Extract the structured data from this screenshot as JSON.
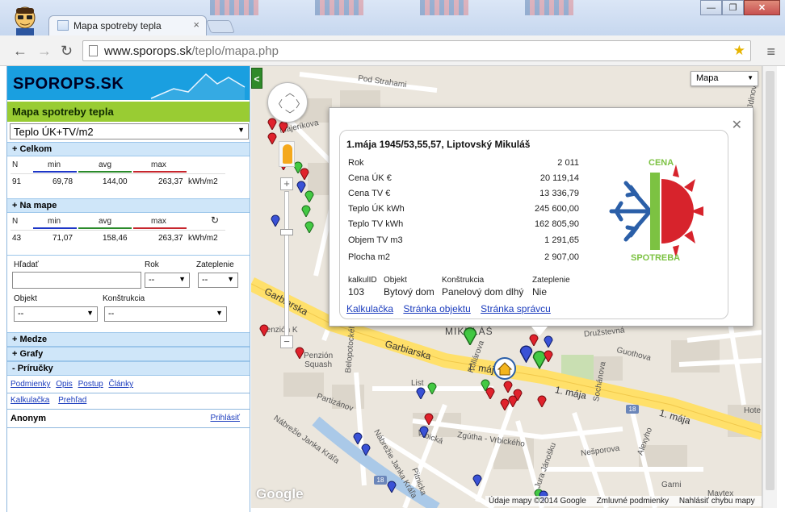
{
  "browser": {
    "tab_title": "Mapa spotreby tepla",
    "url_host": "www.sporops.sk",
    "url_path": "/teplo/mapa.php"
  },
  "sidebar": {
    "logo": "SPOROPS.SK",
    "map_title": "Mapa spotreby tepla",
    "metric_select": "Teplo ÚK+TV/m2",
    "celkom": {
      "header": "+ Celkom",
      "labels": {
        "n": "N",
        "min": "min",
        "avg": "avg",
        "max": "max"
      },
      "values": {
        "n": "91",
        "min": "69,78",
        "avg": "144,00",
        "max": "263,37",
        "unit": "kWh/m2"
      }
    },
    "na_mape": {
      "header": "+ Na mape",
      "labels": {
        "n": "N",
        "min": "min",
        "avg": "avg",
        "max": "max"
      },
      "values": {
        "n": "43",
        "min": "71,07",
        "avg": "158,46",
        "max": "263,37",
        "unit": "kWh/m2"
      }
    },
    "filters": {
      "search_label": "Hľadať",
      "search_value": "",
      "rok_label": "Rok",
      "rok_value": "--",
      "zateplenie_label": "Zateplenie",
      "zateplenie_value": "--",
      "objekt_label": "Objekt",
      "objekt_value": "--",
      "konstrukcia_label": "Konštrukcia",
      "konstrukcia_value": "--"
    },
    "sections": {
      "medze": "+ Medze",
      "grafy": "+ Grafy",
      "prirucky": "- Príručky"
    },
    "links_row1": [
      "Podmienky",
      "Opis",
      "Postup",
      "Články"
    ],
    "links_row2": [
      "Kalkulačka",
      "Prehľad"
    ],
    "user": "Anonym",
    "login": "Prihlásiť"
  },
  "map": {
    "type_select": "Mapa",
    "collapse": "<",
    "streets": {
      "pod_strahami": "Pod Strahami",
      "majerikova": "Majeríkova",
      "garbiarska1": "Garbiarska",
      "garbiarska2": "Garbiarska",
      "maja1": "1. mája",
      "maja2": "1. mája",
      "maja3": "1. mája",
      "penzion_k": "Penzión K",
      "pension_squash": "Penzión\nSquash",
      "partizanov": "Partizánov",
      "belopotockeho": "Belopotockého",
      "nabrezie_janka_krala1": "Nábrežie Janka Kráľa",
      "nabrezie_janka_krala2": "Nábrežie Janka Kráľa",
      "pitnicka": "Pitnicka",
      "zgutha": "Zgútha - Vrbického",
      "jura_janosku": "Jura Jánošku",
      "nesporova": "Nešporova",
      "druzstevna": "Družstevná",
      "guothova": "Guothova",
      "sochanova": "Sochánova",
      "alexyho": "Alexyho",
      "mikulas": "MIKULÁŠ",
      "hote": "Hote",
      "garni": "Garni",
      "maytex": "Maytex",
      "vrbicka": "Vrbická",
      "kollarova": "Kollárova",
      "list": "List",
      "dinovo": "Jdinovo"
    },
    "shield_18": "18",
    "google": "Google",
    "footer": [
      "Údaje mapy ©2014 Google",
      "Zmluvné podmienky",
      "Nahlásiť chybu mapy"
    ]
  },
  "popup": {
    "title": "1.mája 1945/53,55,57, Liptovský Mikuláš",
    "rows": [
      {
        "label": "Rok",
        "value": "2 011"
      },
      {
        "label": "Cena ÚK €",
        "value": "20 119,14"
      },
      {
        "label": "Cena TV €",
        "value": "13 336,79"
      },
      {
        "label": "Teplo ÚK kWh",
        "value": "245 600,00"
      },
      {
        "label": "Teplo TV kWh",
        "value": "162 805,90"
      },
      {
        "label": "Objem TV m3",
        "value": "1 291,65"
      },
      {
        "label": "Plocha m2",
        "value": "2 907,00"
      }
    ],
    "grid_headers": [
      "kalkulID",
      "Objekt",
      "Konštrukcia",
      "Zateplenie"
    ],
    "grid_values": [
      "103",
      "Bytový dom",
      "Panelový dom dlhý",
      "Nie"
    ],
    "links": [
      "Kalkulačka",
      "Stránka objektu",
      "Stránka správcu"
    ],
    "logo_top": "CENA",
    "logo_bottom": "SPOTREBA"
  },
  "colors": {
    "sidebar_blue": "#1a9fe0",
    "title_green": "#99cc33",
    "min_line": "#1d36c7",
    "avg_line": "#2a8a2a",
    "max_line": "#c7262d",
    "marker_red": "#e0222c",
    "marker_green": "#43c943",
    "marker_blue": "#3a52d6"
  }
}
